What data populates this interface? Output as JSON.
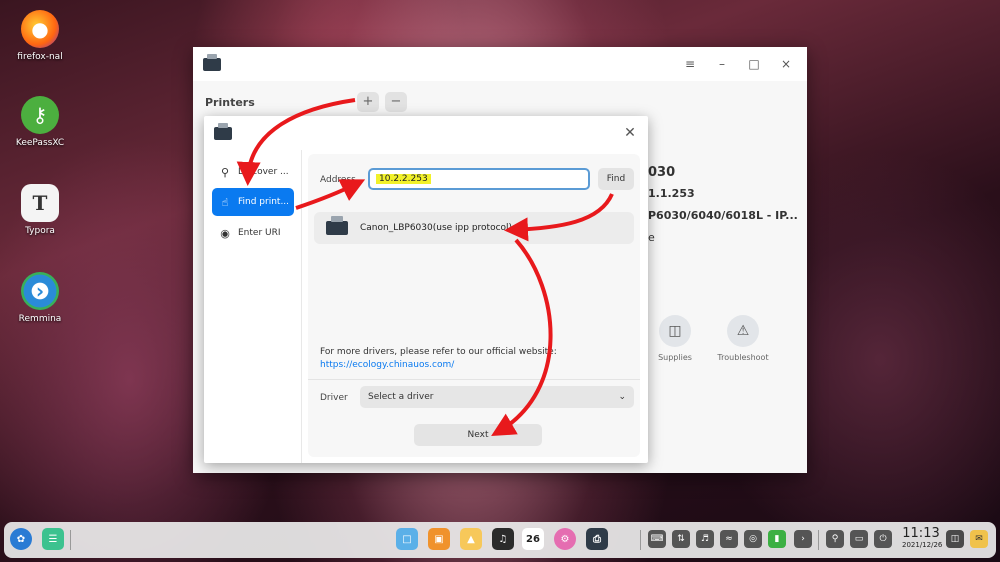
{
  "desktop": {
    "icons": [
      {
        "label": "firefox-nal",
        "icon": "firefox-icon"
      },
      {
        "label": "KeePassXC",
        "icon": "keepassxc-icon"
      },
      {
        "label": "Typora",
        "icon": "typora-icon"
      },
      {
        "label": "Remmina",
        "icon": "remmina-icon"
      }
    ]
  },
  "main_window": {
    "printers_header": "Printers",
    "add_button": "+",
    "remove_button": "−",
    "controls": {
      "menu": "≡",
      "minimize": "–",
      "maximize": "□",
      "close": "×"
    },
    "detail_lines": [
      "030",
      "1.1.253",
      "P6030/6040/6018L - IP...",
      "e"
    ],
    "supplies_label": "Supplies",
    "troubleshoot_label": "Troubleshoot"
  },
  "dialog": {
    "nav": [
      {
        "label": "Discover ...",
        "icon": "discover-icon"
      },
      {
        "label": "Find print...",
        "icon": "hand-pointer-icon"
      },
      {
        "label": "Enter URI",
        "icon": "location-pin-icon"
      }
    ],
    "address_label": "Address",
    "address_value": "10.2.2.253",
    "find_label": "Find",
    "result_label": "Canon_LBP6030(use ipp protocol)",
    "more_drivers_text": "For more drivers, please refer to our official website:",
    "more_drivers_link": "https://ecology.chinauos.com/",
    "driver_label": "Driver",
    "driver_select": "Select a driver",
    "next_label": "Next"
  },
  "taskbar": {
    "time": "11:13",
    "date": "2021/12/26",
    "calendar_day": "26"
  },
  "colors": {
    "accent": "#0a7af0",
    "highlight": "#f1f12a",
    "annotation_arrow": "#e8191c"
  }
}
